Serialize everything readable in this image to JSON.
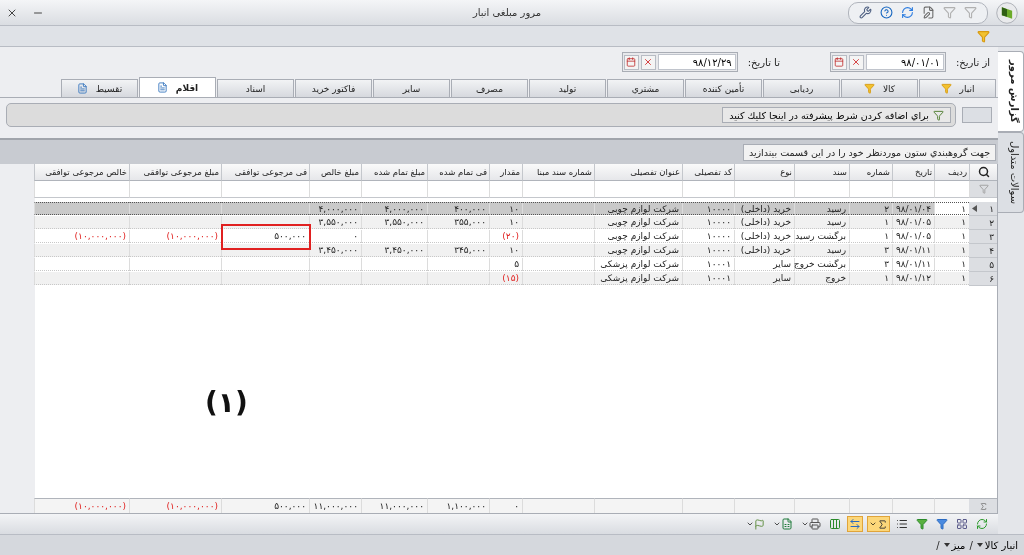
{
  "window": {
    "title": "مرور مبلغی انبار"
  },
  "side_tabs": [
    {
      "label": "گزارش مرور",
      "selected": true
    },
    {
      "label": "سوالات متداول",
      "selected": false
    }
  ],
  "date_range": {
    "from_label": "از تاریخ:",
    "from_value": "۹۸/۰۱/۰۱",
    "to_label": "تا تاریخ:",
    "to_value": "۹۸/۱۲/۲۹"
  },
  "tabs": [
    {
      "label": "انبار",
      "selected": false,
      "kind": "filter"
    },
    {
      "label": "کالا",
      "selected": false,
      "kind": "filter"
    },
    {
      "label": "ردیابی",
      "selected": false,
      "kind": "plain"
    },
    {
      "label": "تأمین کننده",
      "selected": false,
      "kind": "plain"
    },
    {
      "label": "مشتري",
      "selected": false,
      "kind": "plain"
    },
    {
      "label": "تولید",
      "selected": false,
      "kind": "plain"
    },
    {
      "label": "مصرف",
      "selected": false,
      "kind": "plain"
    },
    {
      "label": "سایر",
      "selected": false,
      "kind": "plain"
    },
    {
      "label": "فاکتور خرید",
      "selected": false,
      "kind": "plain"
    },
    {
      "label": "اسناد",
      "selected": false,
      "kind": "plain"
    },
    {
      "label": "اقلام",
      "selected": true,
      "kind": "note"
    },
    {
      "label": "تقسیط",
      "selected": false,
      "kind": "note"
    }
  ],
  "advanced_filter": {
    "button": "براي اضافه کردن شرط پيشرفته در اينجا کليك کنيد"
  },
  "group_panel": {
    "hint": "جهت گروهبندي ستون موردنظر خود را در اين قسمت بيندازيد"
  },
  "table": {
    "columns": [
      "ردیف",
      "تاریخ",
      "شماره",
      "سند",
      "نوع",
      "کد تفصیلی",
      "عنوان تفصیلی",
      "شماره سند مبنا",
      "مقدار",
      "فی تمام شده",
      "مبلغ تمام شده",
      "مبلغ خالص",
      "فی مرجوعی توافقی",
      "مبلغ مرجوعی توافقی",
      "خالص مرجوعی توافقی"
    ],
    "rows": [
      {
        "number": "۱",
        "selected": true,
        "cells": [
          "۱",
          "۹۸/۰۱/۰۴",
          "۲",
          "رسید",
          "خرید (داخلی)",
          "۱۰۰۰۰",
          "شرکت لوازم چوبی",
          null,
          "۱۰",
          "۴۰۰,۰۰۰",
          "۴,۰۰۰,۰۰۰",
          "۴,۰۰۰,۰۰۰"
        ]
      },
      {
        "number": "۲",
        "selected": false,
        "cells": [
          "۱",
          "۹۸/۰۱/۰۵",
          "۱",
          "رسید",
          "خرید (داخلی)",
          "۱۰۰۰۰",
          "شرکت لوازم چوبی",
          null,
          "۱۰",
          "۳۵۵,۰۰۰",
          "۳,۵۵۰,۰۰۰",
          "۳,۵۵۰,۰۰۰"
        ]
      },
      {
        "number": "۳",
        "selected": false,
        "cells": [
          "۱",
          "۹۸/۰۱/۰۵",
          "۱",
          "برگشت رسید",
          "خرید (داخلی)",
          "۱۰۰۰۰",
          "شرکت لوازم چوبی",
          null,
          {
            "text": "(۲۰)",
            "negative": true
          },
          null,
          null,
          "۰",
          {
            "text": "۵۰۰,۰۰۰",
            "boxed": true
          },
          {
            "text": "(۱۰,۰۰۰,۰۰۰)",
            "negative": true
          },
          {
            "text": "(۱۰,۰۰۰,۰۰۰)",
            "negative": true
          }
        ]
      },
      {
        "number": "۴",
        "selected": false,
        "cells": [
          "۱",
          "۹۸/۰۱/۱۱",
          "۳",
          "رسید",
          "خرید (داخلی)",
          "۱۰۰۰۰",
          "شرکت لوازم چوبی",
          null,
          "۱۰",
          "۳۴۵,۰۰۰",
          "۳,۴۵۰,۰۰۰",
          "۳,۴۵۰,۰۰۰"
        ]
      },
      {
        "number": "۵",
        "selected": false,
        "cells": [
          "۱",
          "۹۸/۰۱/۱۱",
          "۳",
          "برگشت خروج",
          "سایر",
          "۱۰۰۰۱",
          "شرکت لوازم پزشکی",
          null,
          "۵"
        ]
      },
      {
        "number": "۶",
        "selected": false,
        "cells": [
          "۱",
          "۹۸/۰۱/۱۲",
          "۱",
          "خروج",
          "سایر",
          "۱۰۰۰۱",
          "شرکت لوازم پزشکی",
          null,
          {
            "text": "(۱۵)",
            "negative": true
          }
        ]
      }
    ],
    "totals": [
      "۰",
      "۱,۱۰۰,۰۰۰",
      "۱۱,۰۰۰,۰۰۰",
      "۱۱,۰۰۰,۰۰۰",
      "۵۰۰,۰۰۰",
      {
        "text": "(۱۰,۰۰۰,۰۰۰)",
        "negative": true
      },
      {
        "text": "(۱۰,۰۰۰,۰۰۰)",
        "negative": true
      }
    ]
  },
  "annotation": "(۱)",
  "status_bar": {
    "separator": "/",
    "items": [
      {
        "label": "انبار کالا"
      },
      {
        "label": "میز"
      }
    ]
  }
}
